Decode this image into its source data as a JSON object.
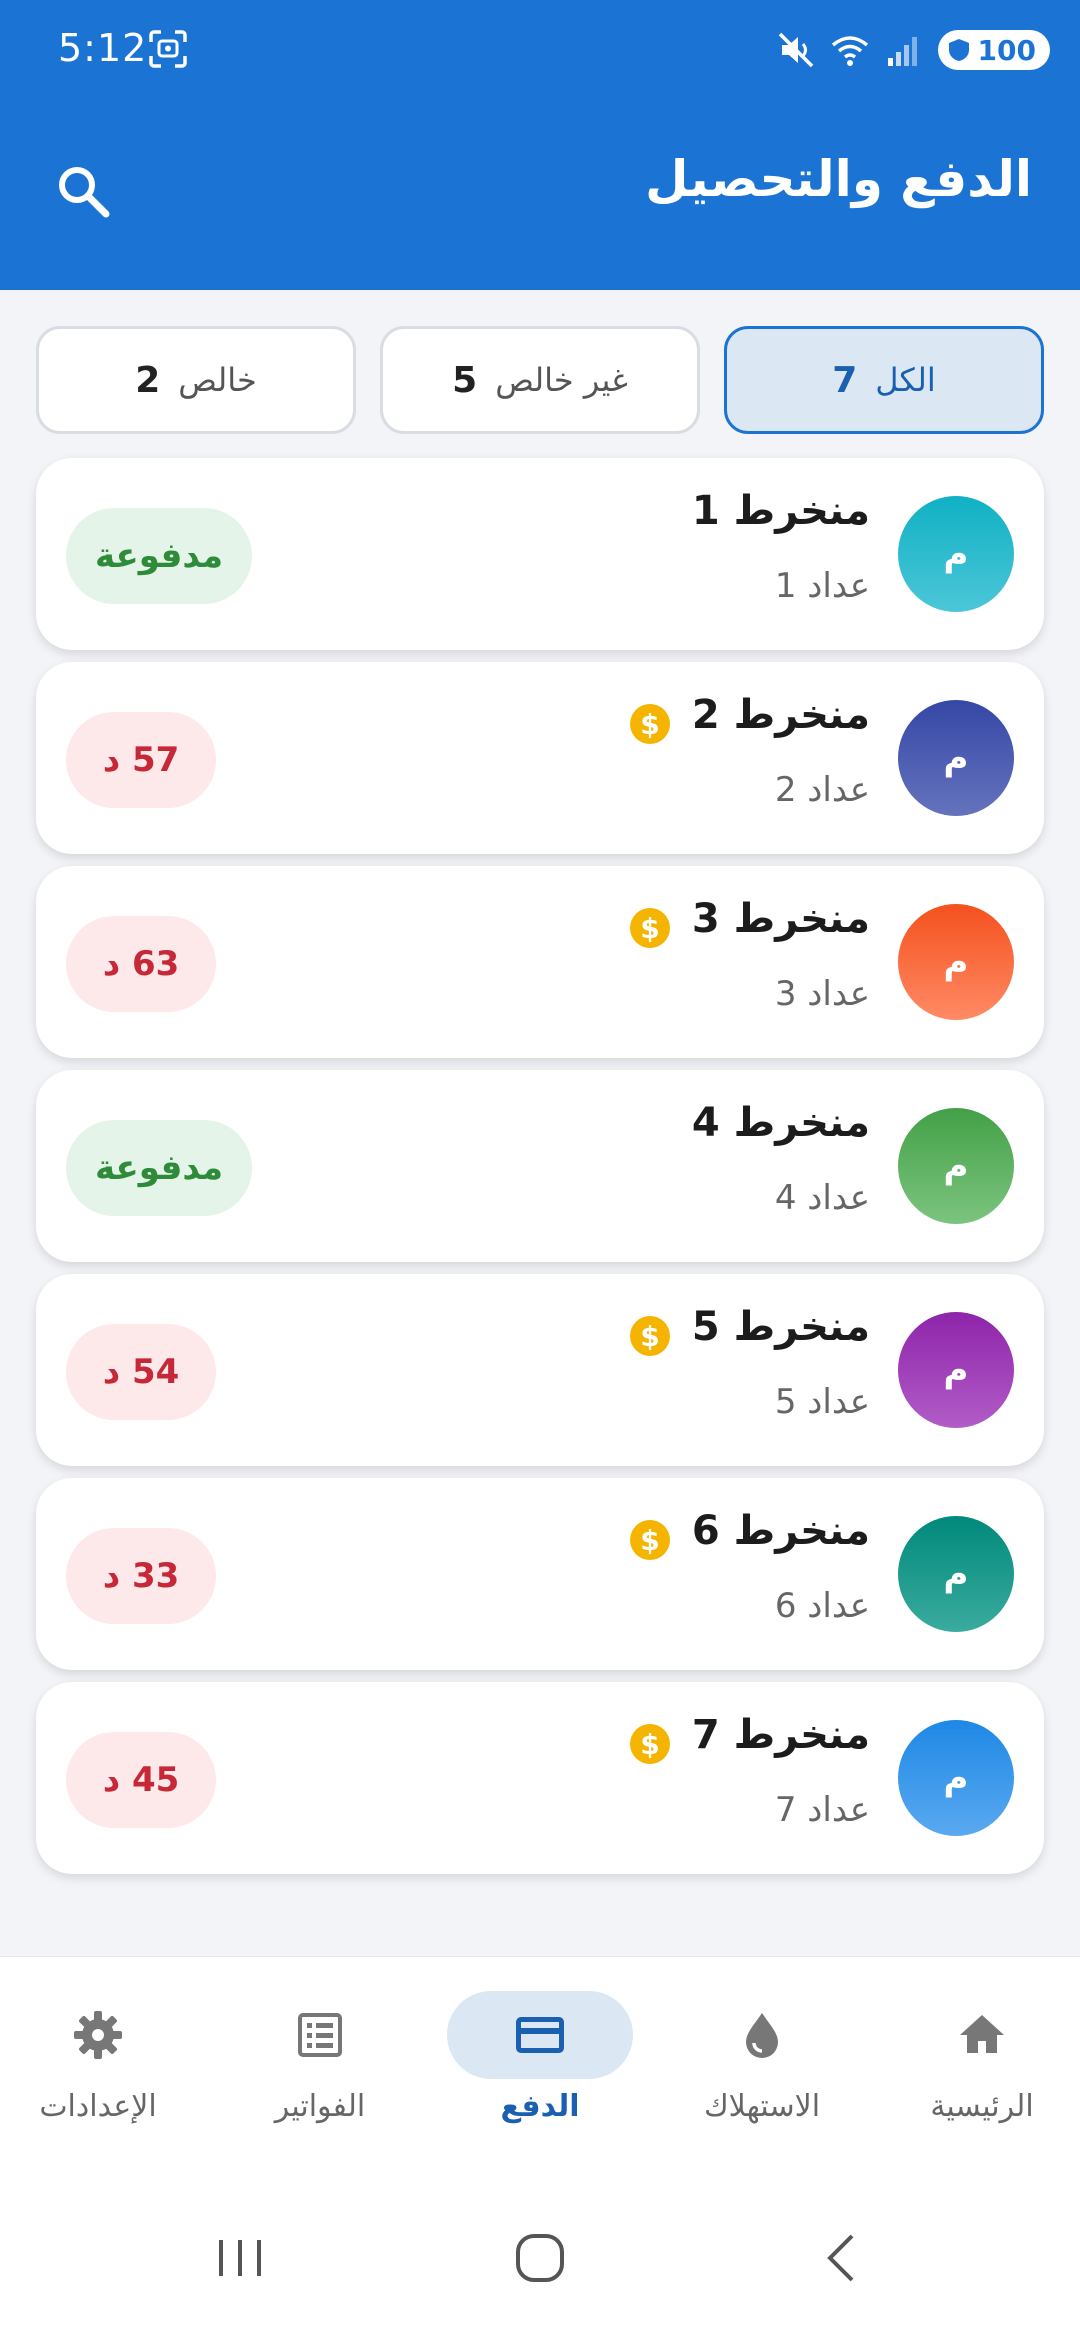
{
  "status_bar": {
    "time": "5:12",
    "battery": "100"
  },
  "app_bar": {
    "title": "الدفع والتحصيل"
  },
  "filters": [
    {
      "label": "الكل",
      "count": "7",
      "active": true
    },
    {
      "label": "غير خالص",
      "count": "5",
      "active": false
    },
    {
      "label": "خالص",
      "count": "2",
      "active": false
    }
  ],
  "avatar_letter": "م",
  "subscribers": [
    {
      "name": "منخرط 1",
      "meter": "عداد 1",
      "status": "paid",
      "badge": "مدفوعة",
      "coin": false,
      "color_top": "#10b0c4",
      "color_bottom": "#4cc7d8"
    },
    {
      "name": "منخرط 2",
      "meter": "عداد 2",
      "status": "due",
      "badge": "57 د",
      "coin": true,
      "color_top": "#3547a6",
      "color_bottom": "#6573bd"
    },
    {
      "name": "منخرط 3",
      "meter": "عداد 3",
      "status": "due",
      "badge": "63 د",
      "coin": true,
      "color_top": "#f4511e",
      "color_bottom": "#ff8a65"
    },
    {
      "name": "منخرط 4",
      "meter": "عداد 4",
      "status": "paid",
      "badge": "مدفوعة",
      "coin": false,
      "color_top": "#43a047",
      "color_bottom": "#7cc47f"
    },
    {
      "name": "منخرط 5",
      "meter": "عداد 5",
      "status": "due",
      "badge": "54 د",
      "coin": true,
      "color_top": "#8e24aa",
      "color_bottom": "#b25cc7"
    },
    {
      "name": "منخرط 6",
      "meter": "عداد 6",
      "status": "due",
      "badge": "33 د",
      "coin": true,
      "color_top": "#00897b",
      "color_bottom": "#3aab9e"
    },
    {
      "name": "منخرط 7",
      "meter": "عداد 7",
      "status": "due",
      "badge": "45 د",
      "coin": true,
      "color_top": "#1e88e5",
      "color_bottom": "#5aa9f0"
    }
  ],
  "coin_symbol": "$",
  "bottom_nav": [
    {
      "label": "الرئيسية",
      "icon": "home-icon",
      "active": false
    },
    {
      "label": "الاستهلاك",
      "icon": "water-drop-icon",
      "active": false
    },
    {
      "label": "الدفع",
      "icon": "credit-card-icon",
      "active": true
    },
    {
      "label": "الفواتير",
      "icon": "receipt-list-icon",
      "active": false
    },
    {
      "label": "الإعدادات",
      "icon": "gear-icon",
      "active": false
    }
  ],
  "colors": {
    "primary": "#1b74d3",
    "paid": "#2e8b3a",
    "due": "#c62838",
    "coin": "#f4b400"
  }
}
